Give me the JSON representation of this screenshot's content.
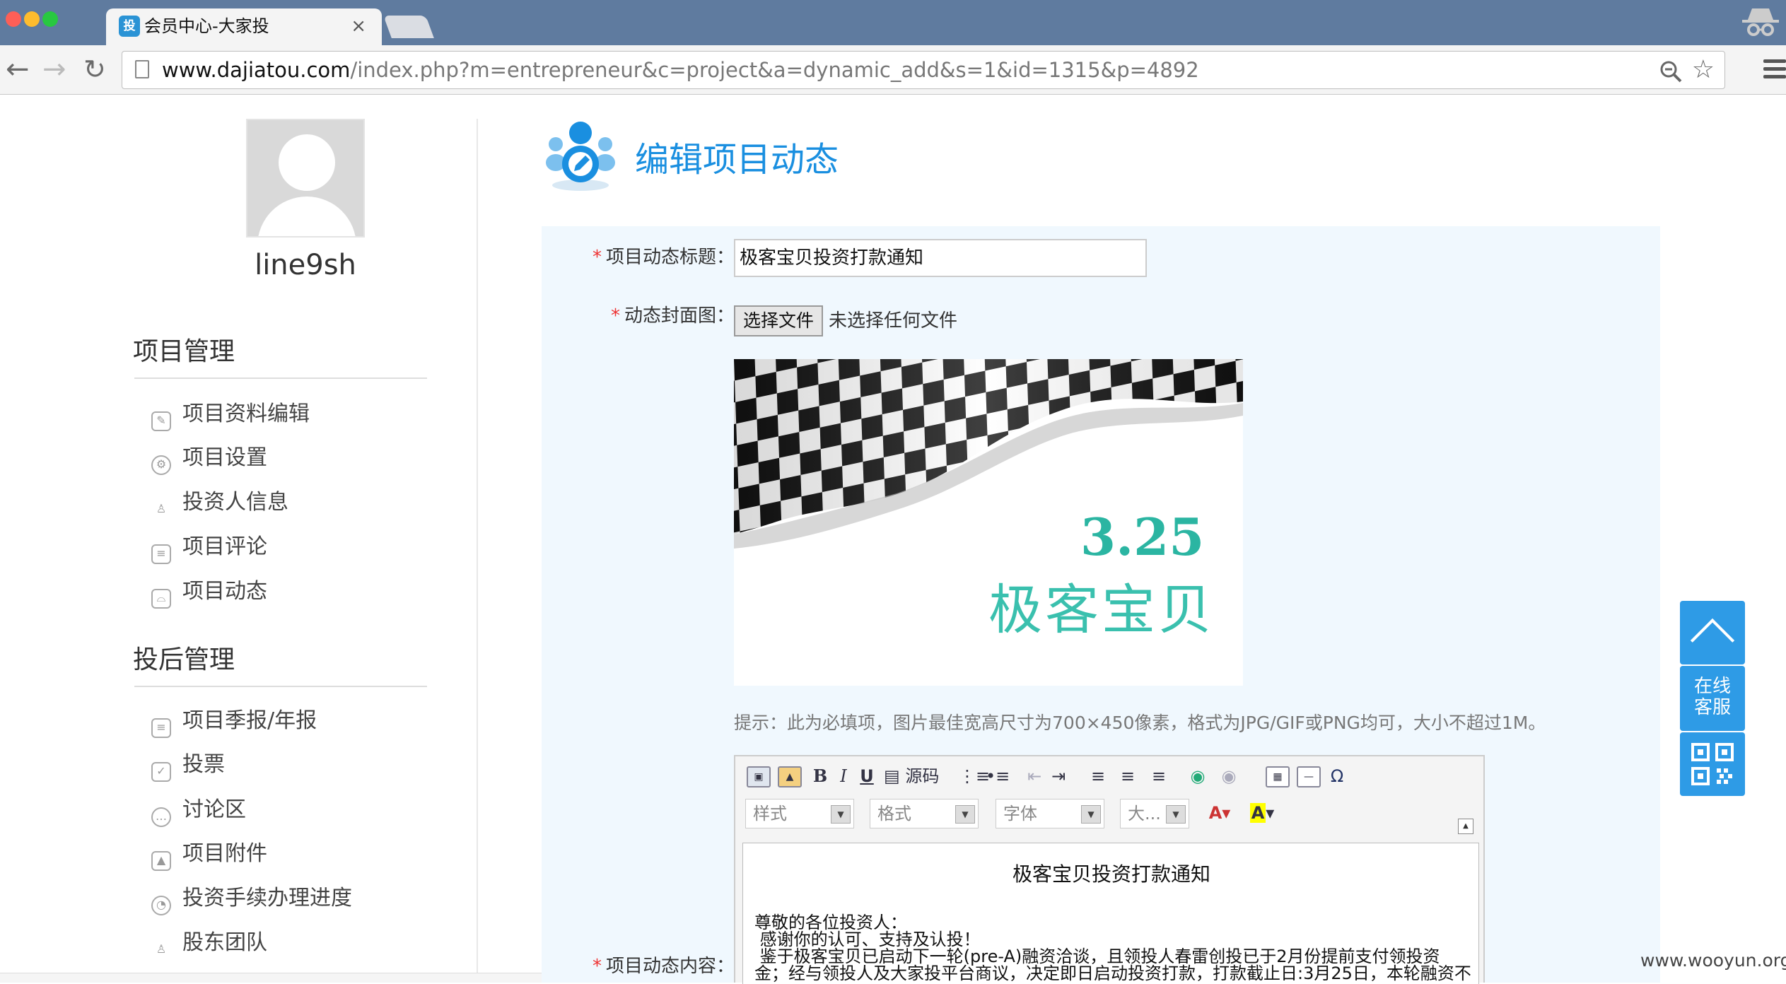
{
  "browser": {
    "tab_title": "会员中心-大家投",
    "tab_close": "×",
    "url_host": "www.dajiatou.com",
    "url_path": "/index.php?m=entrepreneur&c=project&a=dynamic_add&s=1&id=1315&p=4892",
    "favicon_text": "投",
    "colors": {
      "tabbar": "#5f7b9f",
      "close": "#fd5f57",
      "minimize": "#febc2e",
      "maximize": "#28c840"
    }
  },
  "sidebar": {
    "username": "line9sh",
    "sections": [
      {
        "title": "项目管理",
        "items": [
          {
            "label": "项目资料编辑",
            "icon": "edit-icon"
          },
          {
            "label": "项目设置",
            "icon": "settings-icon"
          },
          {
            "label": "投资人信息",
            "icon": "person-icon"
          },
          {
            "label": "项目评论",
            "icon": "comment-icon"
          },
          {
            "label": "项目动态",
            "icon": "chart-icon"
          }
        ]
      },
      {
        "title": "投后管理",
        "items": [
          {
            "label": "项目季报/年报",
            "icon": "report-icon"
          },
          {
            "label": "投票",
            "icon": "vote-icon"
          },
          {
            "label": "讨论区",
            "icon": "discussion-icon"
          },
          {
            "label": "项目附件",
            "icon": "attachment-icon"
          },
          {
            "label": "投资手续办理进度",
            "icon": "progress-icon"
          },
          {
            "label": "股东团队",
            "icon": "team-icon"
          }
        ]
      }
    ]
  },
  "main": {
    "title": "编辑项目动态",
    "accent": "#1a8fe0",
    "form": {
      "required_mark": "*",
      "title_label": "项目动态标题：",
      "title_value": "极客宝贝投资打款通知",
      "cover_label": "动态封面图：",
      "choose_file_button": "选择文件",
      "no_file_text": "未选择任何文件",
      "cover_image": {
        "date_text": "3.25",
        "name_text": "极客宝贝"
      },
      "hint": "提示：此为必填项，图片最佳宽高尺寸为700×450像素，格式为JPG/GIF或PNG均可，大小不超过1M。",
      "content_label": "项目动态内容："
    },
    "editor": {
      "toolbar_source": "源码",
      "style_combo": "样式",
      "format_combo": "格式",
      "font_combo": "字体",
      "size_combo": "大...",
      "doc_title": "极客宝贝投资打款通知",
      "doc_lines": [
        "尊敬的各位投资人：",
        " 感谢你的认可、支持及认投！",
        " 鉴于极客宝贝已启动下一轮(pre-A)融资洽谈，且领投人春雷创投已于2月份提前支付领投资",
        "金；经与领投人及大家投平台商议，决定即日启动投资打款，打款截止日:3月25日，本轮融资不"
      ]
    }
  },
  "floating": {
    "customer_service": "在线\n客服"
  },
  "watermark": "www.wooyun.org"
}
